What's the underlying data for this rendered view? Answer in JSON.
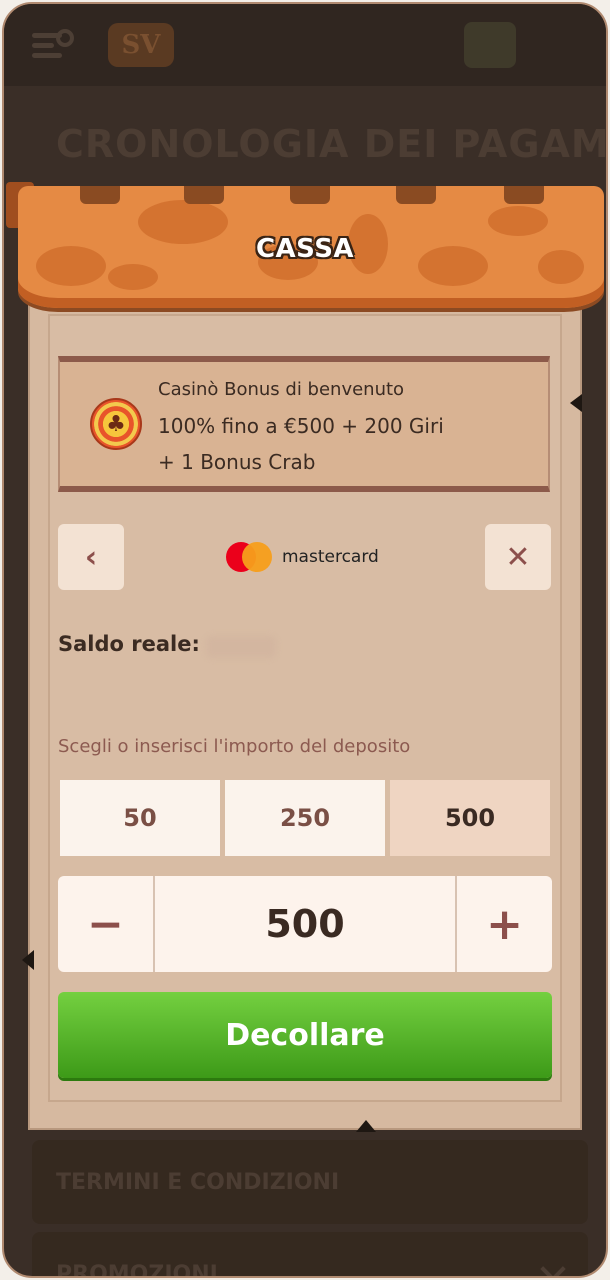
{
  "background": {
    "logo": "SV",
    "page_title": "CRONOLOGIA DEI PAGAMENTI",
    "rows": [
      "TERMINI E CONDIZIONI",
      "PROMOZIONI"
    ]
  },
  "modal": {
    "title": "CASSA",
    "bonus": {
      "line1": "Casinò Bonus di benvenuto",
      "line2": "100% fino a €500 + 200 Giri",
      "line3": "+ 1 Bonus Crab"
    },
    "payment": {
      "back_label": "‹",
      "close_label": "✕",
      "method": "mastercard"
    },
    "balance_label": "Saldo reale:",
    "deposit_prompt": "Scegli o inserisci l'importo del deposito",
    "amounts": [
      "50",
      "250",
      "500"
    ],
    "selected_amount": "500",
    "stepper": {
      "minus": "−",
      "value": "500",
      "plus": "+"
    },
    "submit_label": "Decollare"
  },
  "colors": {
    "awning": "#e58a44",
    "cta": "#4caf24",
    "panel": "#d8bca4"
  },
  "icons": {
    "back": "chevron-left-icon",
    "close": "close-icon",
    "chip": "casino-chip-icon",
    "menu": "menu-search-icon"
  }
}
